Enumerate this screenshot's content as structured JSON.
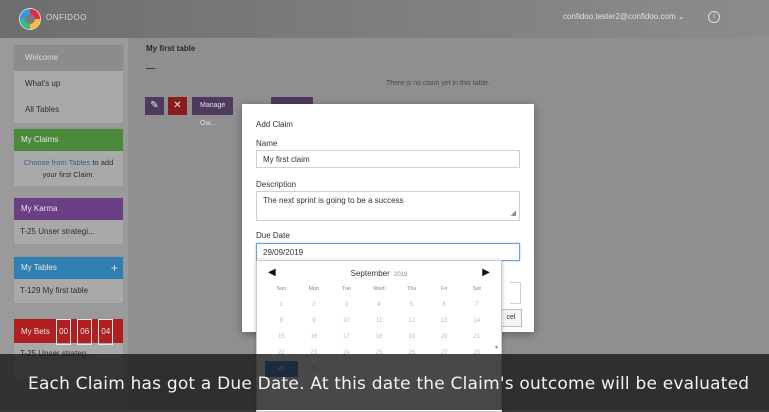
{
  "app": {
    "logo_text": "ONFIDOO",
    "user_email": "confidoo.tester2@confidoo.com ⌄",
    "info_icon": "info-icon"
  },
  "sidebar": {
    "nav": [
      {
        "label": "Welcome",
        "active": true
      },
      {
        "label": "What's up",
        "active": false
      },
      {
        "label": "All Tables",
        "active": false
      }
    ],
    "my_claims": {
      "header": "My Claims",
      "link": "Choose from Tables",
      "text": "to add your first Claim.",
      "color": "#4a8a3a"
    },
    "my_karma": {
      "header": "My Karma",
      "item": "T-25 Unser strategi...",
      "color": "#6a3f86"
    },
    "my_tables": {
      "header": "My Tables",
      "plus": "+",
      "item": "T-129 My first table",
      "color": "#2f7fb0"
    },
    "my_bets": {
      "header": "My Bets",
      "nums": [
        "00",
        "06",
        "04"
      ],
      "item": "T-25 Unser strateg...",
      "color": "#b02020"
    }
  },
  "main": {
    "title": "My first table",
    "empty_text": "There is no claim yet in this table.",
    "buttons": {
      "edit_icon": "✎",
      "delete_icon": "✕",
      "manage_label": "Manage Ow..."
    }
  },
  "modal": {
    "title": "Add Claim",
    "name_label": "Name",
    "name_value": "My first claim",
    "description_label": "Description",
    "description_value": "The next sprint is going to be a success",
    "due_label": "Due Date",
    "due_value": "29/09/2019",
    "cancel_label": "cel"
  },
  "datepicker": {
    "month": "September",
    "year": "2019",
    "prev": "◀",
    "next": "▶",
    "dow": [
      "Sun",
      "Mon",
      "Tue",
      "Wed",
      "Thu",
      "Fri",
      "Sat"
    ],
    "weeks": [
      [
        "1",
        "2",
        "3",
        "4",
        "5",
        "6",
        "7"
      ],
      [
        "8",
        "9",
        "10",
        "11",
        "12",
        "13",
        "14"
      ],
      [
        "15",
        "16",
        "17",
        "18",
        "19",
        "20",
        "21"
      ],
      [
        "22",
        "23",
        "24",
        "25",
        "26",
        "27",
        "28"
      ],
      [
        "29",
        "30",
        "",
        "",
        "",
        "",
        ""
      ]
    ],
    "selected": "29"
  },
  "caption": {
    "text": "Each Claim has got a Due Date. At this date the Claim's outcome will be evaluated"
  }
}
